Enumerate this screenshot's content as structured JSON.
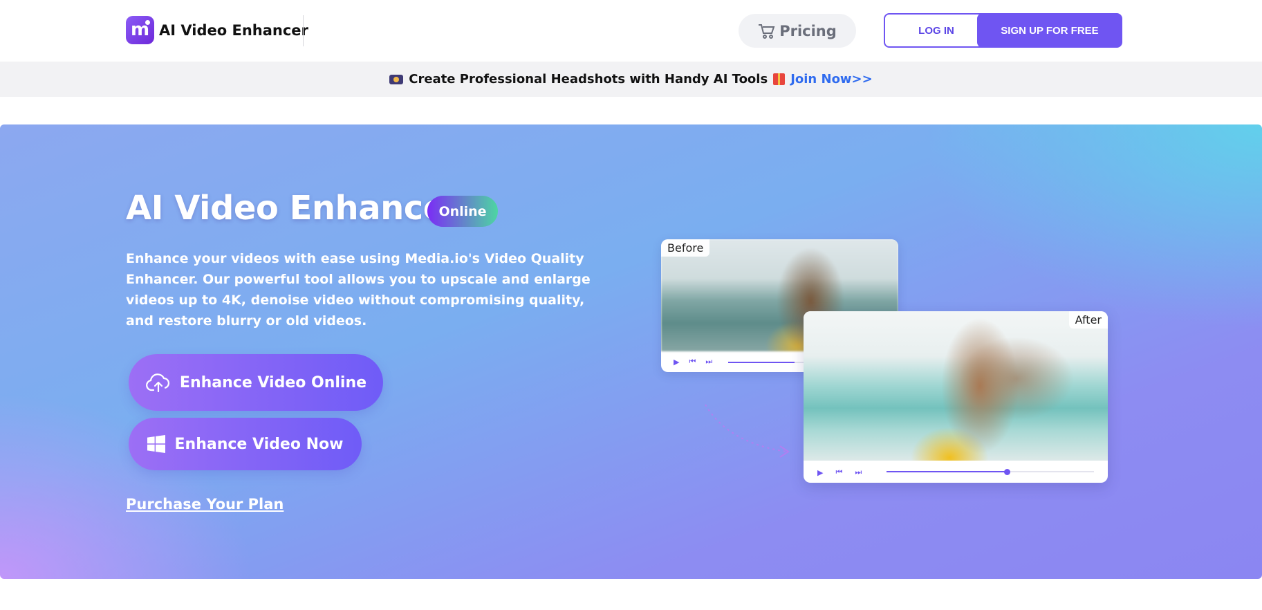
{
  "header": {
    "logo_text": "AI Video Enhancer",
    "pricing_label": "Pricing",
    "login_label": "LOG IN",
    "signup_label": "SIGN UP FOR FREE"
  },
  "banner": {
    "text": "Create Professional Headshots with Handy AI Tools",
    "link_text": "Join Now>>"
  },
  "hero": {
    "title": "AI Video Enhancer",
    "badge": "Online",
    "description": "Enhance your videos with ease using Media.io's Video Quality Enhancer. Our powerful tool allows you to upscale and enlarge videos up to 4K, denoise video without compromising quality, and restore blurry or old videos.",
    "enhance_online_label": "Enhance Video Online",
    "enhance_now_label": "Enhance Video Now",
    "purchase_label": "Purchase Your Plan"
  },
  "preview": {
    "before_label": "Before",
    "after_label": "After",
    "before_progress": 0.4,
    "after_progress": 0.58
  },
  "colors": {
    "accent": "#6f55f2",
    "link": "#2f6bef"
  }
}
